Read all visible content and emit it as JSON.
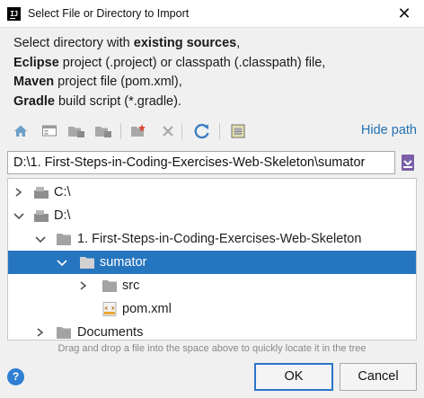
{
  "window": {
    "title": "Select File or Directory to Import",
    "close_glyph": "✕",
    "app_icon": "IJ"
  },
  "description": {
    "line1_pre": "Select directory with ",
    "line1_bold": "existing sources",
    "line1_post": ",",
    "line2_bold": "Eclipse",
    "line2_post": " project (.project) or classpath (.classpath) file,",
    "line3_bold": "Maven",
    "line3_post": " project file (pom.xml),",
    "line4_bold": "Gradle",
    "line4_post": " build script (*.gradle)."
  },
  "toolbar": {
    "icons": [
      "home-icon",
      "desktop-icon",
      "project-folder-icon",
      "module-folder-icon",
      "new-folder-icon",
      "delete-icon",
      "refresh-icon",
      "show-hidden-icon"
    ],
    "hide_path_label": "Hide path"
  },
  "path": {
    "value": "D:\\1. First-Steps-in-Coding-Exercises-Web-Skeleton\\sumator"
  },
  "tree": {
    "items": [
      {
        "label": "C:\\",
        "expanded": false,
        "icon": "drive-icon"
      },
      {
        "label": "D:\\",
        "expanded": true,
        "icon": "drive-icon"
      },
      {
        "label": "1. First-Steps-in-Coding-Exercises-Web-Skeleton",
        "expanded": true,
        "icon": "folder-icon"
      },
      {
        "label": "sumator",
        "expanded": true,
        "icon": "folder-icon",
        "selected": true
      },
      {
        "label": "src",
        "expanded": false,
        "icon": "folder-icon"
      },
      {
        "label": "pom.xml",
        "icon": "maven-file-icon"
      },
      {
        "label": "Documents",
        "expanded": false,
        "icon": "folder-icon"
      }
    ]
  },
  "hint": "Drag and drop a file into the space above to quickly locate it in the tree",
  "footer": {
    "help_glyph": "?",
    "ok_label": "OK",
    "cancel_label": "Cancel"
  },
  "colors": {
    "selection": "#2675bf",
    "link": "#2470b3",
    "help": "#2f7fd3",
    "default_border": "#2b73c9"
  }
}
